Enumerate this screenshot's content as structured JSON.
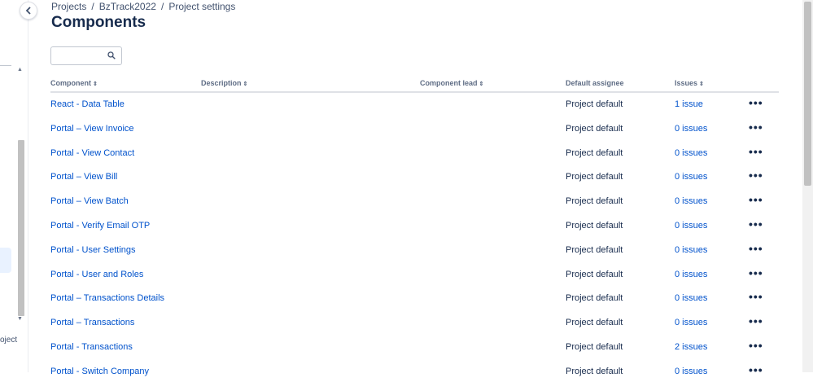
{
  "breadcrumb": [
    "Projects",
    "BzTrack2022",
    "Project settings"
  ],
  "page_title": "Components",
  "search": {
    "value": "",
    "placeholder": ""
  },
  "sidebar": {
    "truncated_text": "oject"
  },
  "columns": {
    "component": "Component",
    "description": "Description",
    "component_lead": "Component lead",
    "default_assignee": "Default assignee",
    "issues": "Issues"
  },
  "rows": [
    {
      "name": "React - Data Table",
      "assignee": "Project default",
      "issues": "1 issue"
    },
    {
      "name": "Portal – View Invoice",
      "assignee": "Project default",
      "issues": "0 issues"
    },
    {
      "name": "Portal - View Contact",
      "assignee": "Project default",
      "issues": "0 issues"
    },
    {
      "name": "Portal – View Bill",
      "assignee": "Project default",
      "issues": "0 issues"
    },
    {
      "name": "Portal – View Batch",
      "assignee": "Project default",
      "issues": "0 issues"
    },
    {
      "name": "Portal - Verify Email OTP",
      "assignee": "Project default",
      "issues": "0 issues"
    },
    {
      "name": "Portal - User Settings",
      "assignee": "Project default",
      "issues": "0 issues"
    },
    {
      "name": "Portal - User and Roles",
      "assignee": "Project default",
      "issues": "0 issues"
    },
    {
      "name": "Portal – Transactions Details",
      "assignee": "Project default",
      "issues": "0 issues"
    },
    {
      "name": "Portal – Transactions",
      "assignee": "Project default",
      "issues": "0 issues"
    },
    {
      "name": "Portal - Transactions",
      "assignee": "Project default",
      "issues": "2 issues"
    },
    {
      "name": "Portal - Switch Company",
      "assignee": "Project default",
      "issues": "0 issues"
    }
  ],
  "more_label": "•••",
  "colors": {
    "link": "#0052cc",
    "text": "#172b4d",
    "header": "#5e6c84"
  }
}
